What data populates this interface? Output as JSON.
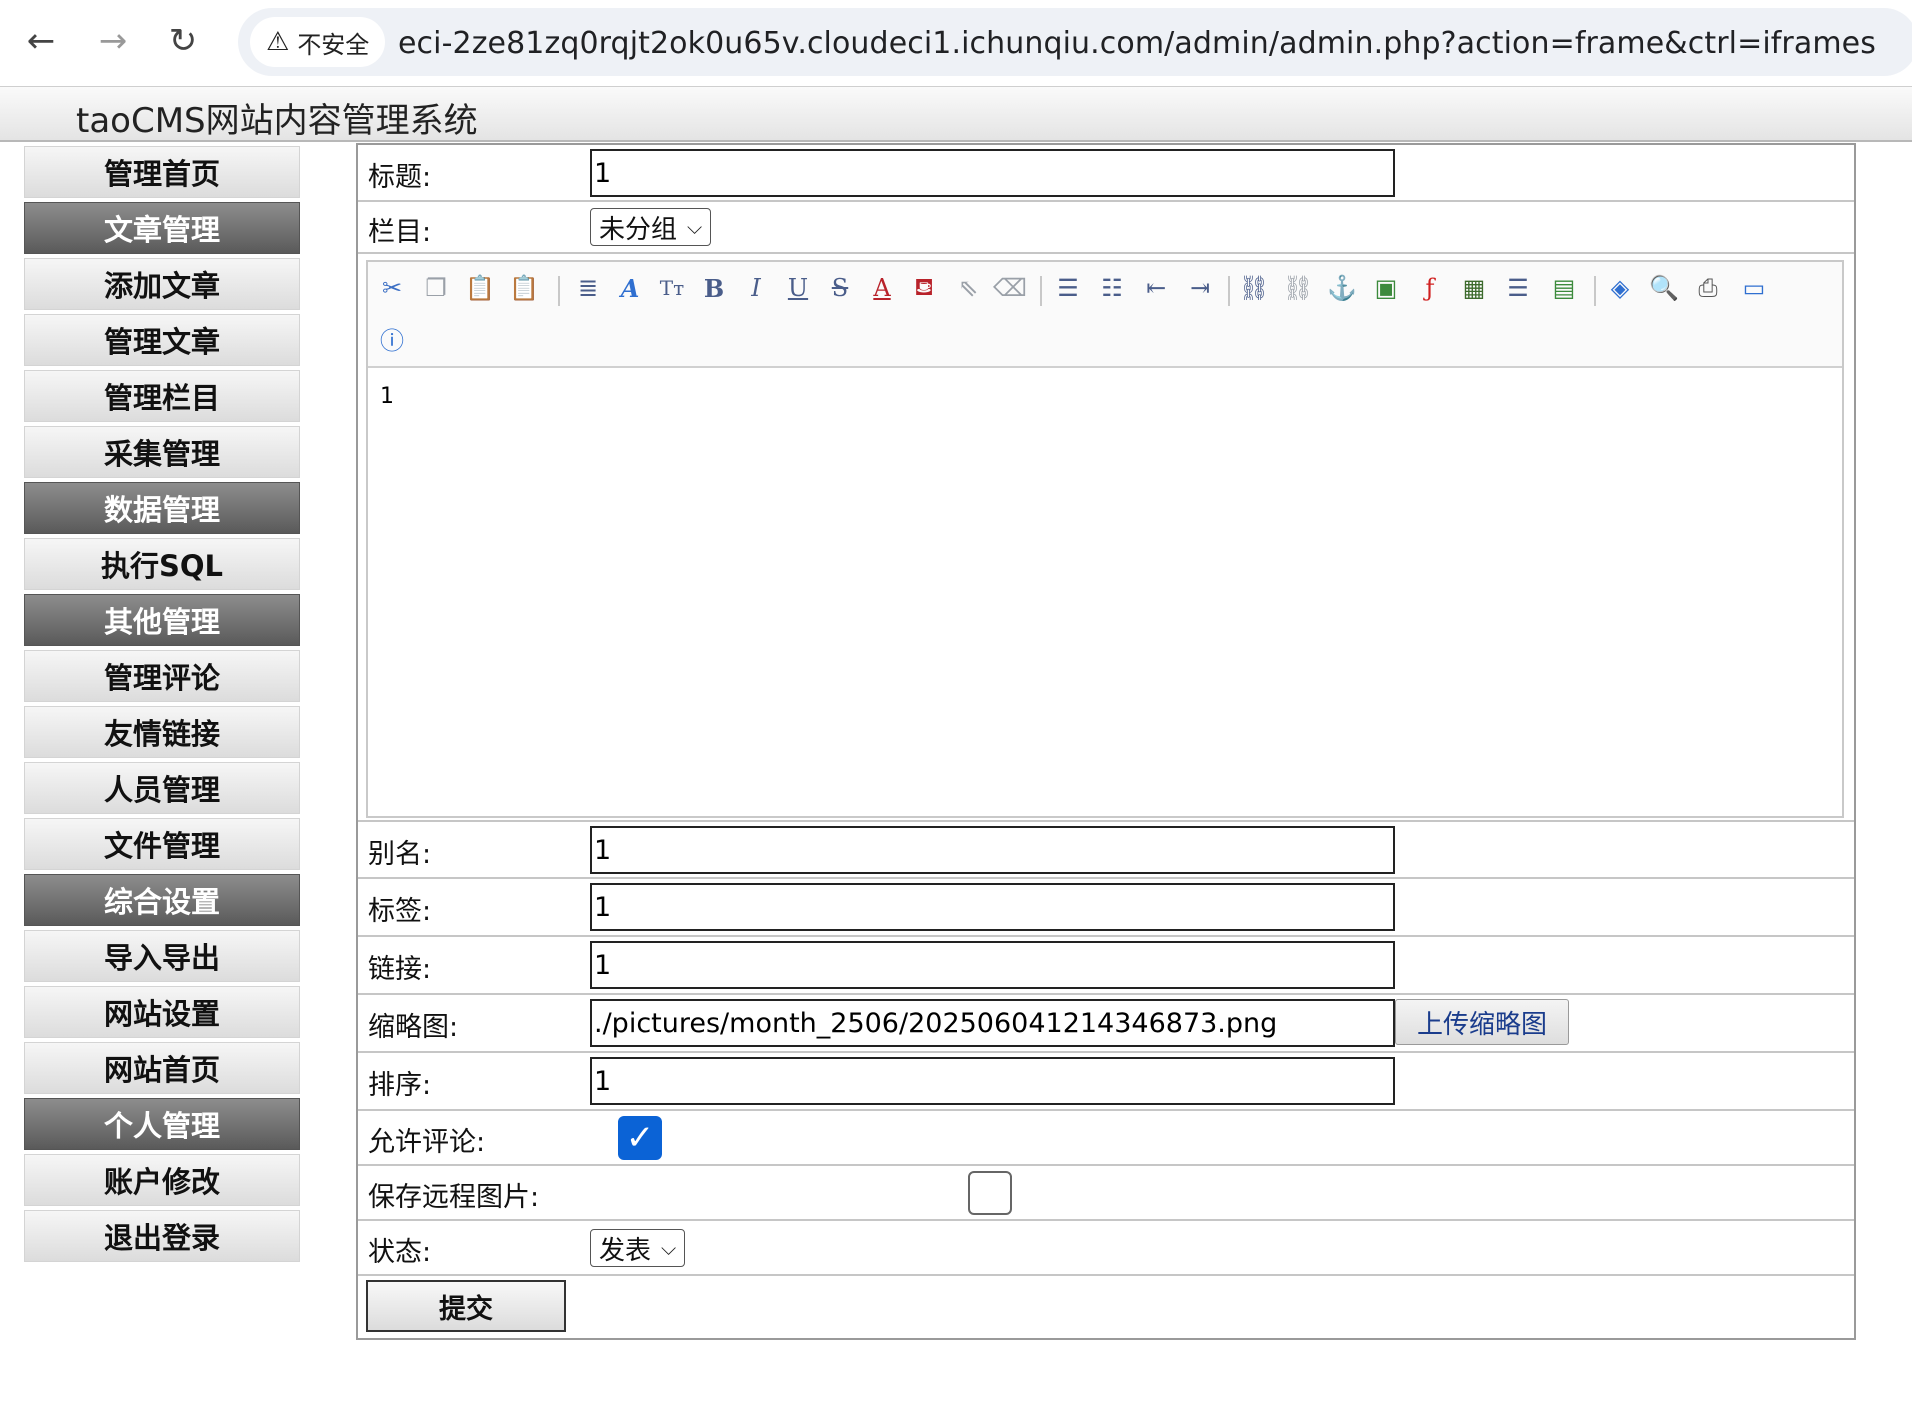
{
  "browser": {
    "back_icon": "back-arrow-icon",
    "forward_icon": "forward-arrow-icon",
    "reload_icon": "reload-icon",
    "security_label": "不安全",
    "url": "eci-2ze81zq0rqjt2ok0u65v.cloudeci1.ichunqiu.com/admin/admin.php?action=frame&ctrl=iframes"
  },
  "header": {
    "title": "taoCMS网站内容管理系统"
  },
  "sidebar": {
    "items": [
      {
        "label": "管理首页",
        "group": false
      },
      {
        "label": "文章管理",
        "group": true
      },
      {
        "label": "添加文章",
        "group": false
      },
      {
        "label": "管理文章",
        "group": false
      },
      {
        "label": "管理栏目",
        "group": false
      },
      {
        "label": "采集管理",
        "group": false
      },
      {
        "label": "数据管理",
        "group": true
      },
      {
        "label": "执行SQL",
        "group": false
      },
      {
        "label": "其他管理",
        "group": true
      },
      {
        "label": "管理评论",
        "group": false
      },
      {
        "label": "友情链接",
        "group": false
      },
      {
        "label": "人员管理",
        "group": false
      },
      {
        "label": "文件管理",
        "group": false
      },
      {
        "label": "综合设置",
        "group": true
      },
      {
        "label": "导入导出",
        "group": false
      },
      {
        "label": "网站设置",
        "group": false
      },
      {
        "label": "网站首页",
        "group": false
      },
      {
        "label": "个人管理",
        "group": true
      },
      {
        "label": "账户修改",
        "group": false
      },
      {
        "label": "退出登录",
        "group": false
      }
    ]
  },
  "form": {
    "title": {
      "label": "标题:",
      "value": "1"
    },
    "category": {
      "label": "栏目:",
      "value": "未分组"
    },
    "editor": {
      "content": "1"
    },
    "alias": {
      "label": "别名:",
      "value": "1"
    },
    "tags": {
      "label": "标签:",
      "value": "1"
    },
    "link": {
      "label": "链接:",
      "value": "1"
    },
    "thumbnail": {
      "label": "缩略图:",
      "value": "./pictures/month_2506/202506041214346873.png",
      "upload_label": "上传缩略图"
    },
    "order": {
      "label": "排序:",
      "value": "1"
    },
    "allow_comment": {
      "label": "允许评论:",
      "checked": true
    },
    "save_remote": {
      "label": "保存远程图片:",
      "checked": false
    },
    "status": {
      "label": "状态:",
      "value": "发表"
    },
    "submit_label": "提交"
  },
  "toolbar_icons": [
    "cut-icon",
    "copy-icon",
    "paste-icon",
    "paste-text-icon",
    "font-family-icon",
    "font-color-style-icon",
    "font-size-icon",
    "bold-icon",
    "italic-icon",
    "underline-icon",
    "strikethrough-icon",
    "text-color-icon",
    "background-color-icon",
    "select-all-icon",
    "remove-format-icon",
    "align-icon",
    "ordered-list-icon",
    "outdent-icon",
    "indent-icon",
    "link-icon",
    "unlink-icon",
    "anchor-icon",
    "image-icon",
    "flash-icon",
    "media-icon",
    "horizontal-rule-icon",
    "table-icon",
    "source-icon",
    "preview-icon",
    "print-icon",
    "fullscreen-icon",
    "about-icon"
  ]
}
